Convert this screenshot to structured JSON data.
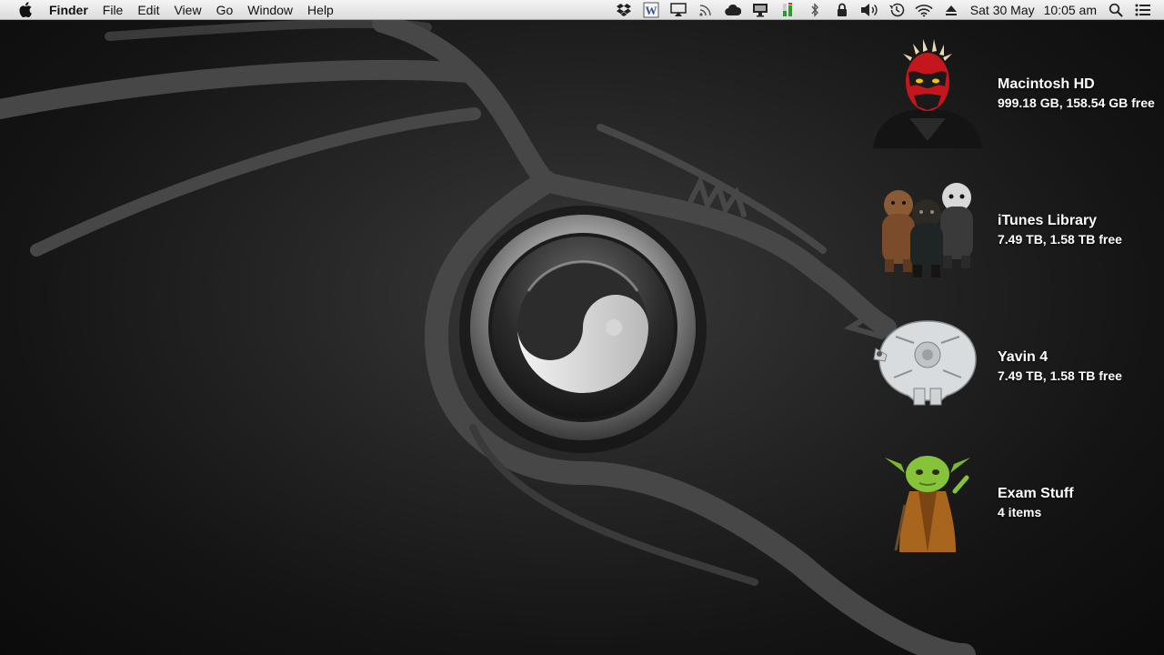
{
  "menubar": {
    "apple_icon": "apple-icon",
    "app_name": "Finder",
    "menus": [
      "File",
      "Edit",
      "View",
      "Go",
      "Window",
      "Help"
    ],
    "status_icons": [
      "dropbox-icon",
      "word-icon",
      "airplay-icon",
      "rss-icon",
      "cloud-icon",
      "monitor-icon",
      "battery-meter-icon",
      "bluetooth-icon",
      "lock-icon",
      "volume-icon",
      "time-machine-icon",
      "wifi-icon",
      "eject-icon"
    ],
    "date": "Sat 30 May",
    "time": "10:05 am",
    "search_icon": "spotlight-search-icon",
    "notifications_icon": "notification-center-icon"
  },
  "desktop": {
    "items": [
      {
        "name": "Macintosh HD",
        "info": "999.18 GB, 158.54 GB free",
        "icon": "darth-maul-drive-icon"
      },
      {
        "name": "iTunes Library",
        "info": "7.49 TB, 1.58 TB free",
        "icon": "ewoks-drive-icon"
      },
      {
        "name": "Yavin 4",
        "info": "7.49 TB, 1.58 TB free",
        "icon": "millennium-falcon-drive-icon"
      },
      {
        "name": "Exam Stuff",
        "info": "4 items",
        "icon": "yoda-folder-icon"
      }
    ]
  },
  "wallpaper": {
    "symbol": "yin-yang-icon",
    "motif": "dragon-silhouette"
  },
  "colors": {
    "menubar_bg": "#e6e6e6",
    "desktop_bg": "#1e1e1e",
    "label_text": "#ffffff"
  }
}
